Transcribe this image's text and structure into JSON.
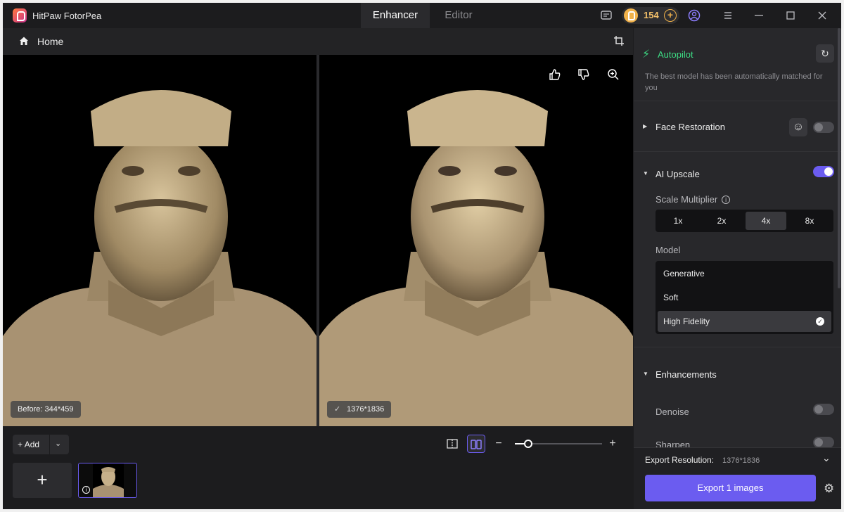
{
  "app": {
    "title": "HitPaw FotorPea"
  },
  "tabs": [
    {
      "label": "Enhancer",
      "active": true
    },
    {
      "label": "Editor",
      "active": false
    }
  ],
  "header": {
    "credits": "154"
  },
  "breadcrumb": {
    "home": "Home"
  },
  "viewer": {
    "before_label": "Before: 344*459",
    "after_label": "1376*1836"
  },
  "bottom": {
    "add_label": "Add",
    "zoom_level": 0.15
  },
  "panel": {
    "autopilot": {
      "label": "Autopilot",
      "description": "The best model has been automatically matched for you"
    },
    "face_restoration": {
      "label": "Face Restoration",
      "enabled": false
    },
    "ai_upscale": {
      "label": "AI Upscale",
      "enabled": true,
      "scale_label": "Scale Multiplier",
      "scales": [
        "1x",
        "2x",
        "4x",
        "8x"
      ],
      "selected_scale": "4x",
      "model_label": "Model",
      "models": [
        "Generative",
        "Soft",
        "High Fidelity"
      ],
      "selected_model": "High Fidelity"
    },
    "enhancements": {
      "label": "Enhancements",
      "denoise": {
        "label": "Denoise",
        "enabled": false
      },
      "sharpen": {
        "label": "Sharpen",
        "enabled": false
      }
    },
    "export": {
      "resolution_label": "Export Resolution:",
      "resolution_value": "1376*1836",
      "button_label": "Export 1 images"
    }
  },
  "colors": {
    "accent": "#6b5cf0",
    "autopilot": "#3ddc84",
    "coin": "#f1b24a"
  }
}
